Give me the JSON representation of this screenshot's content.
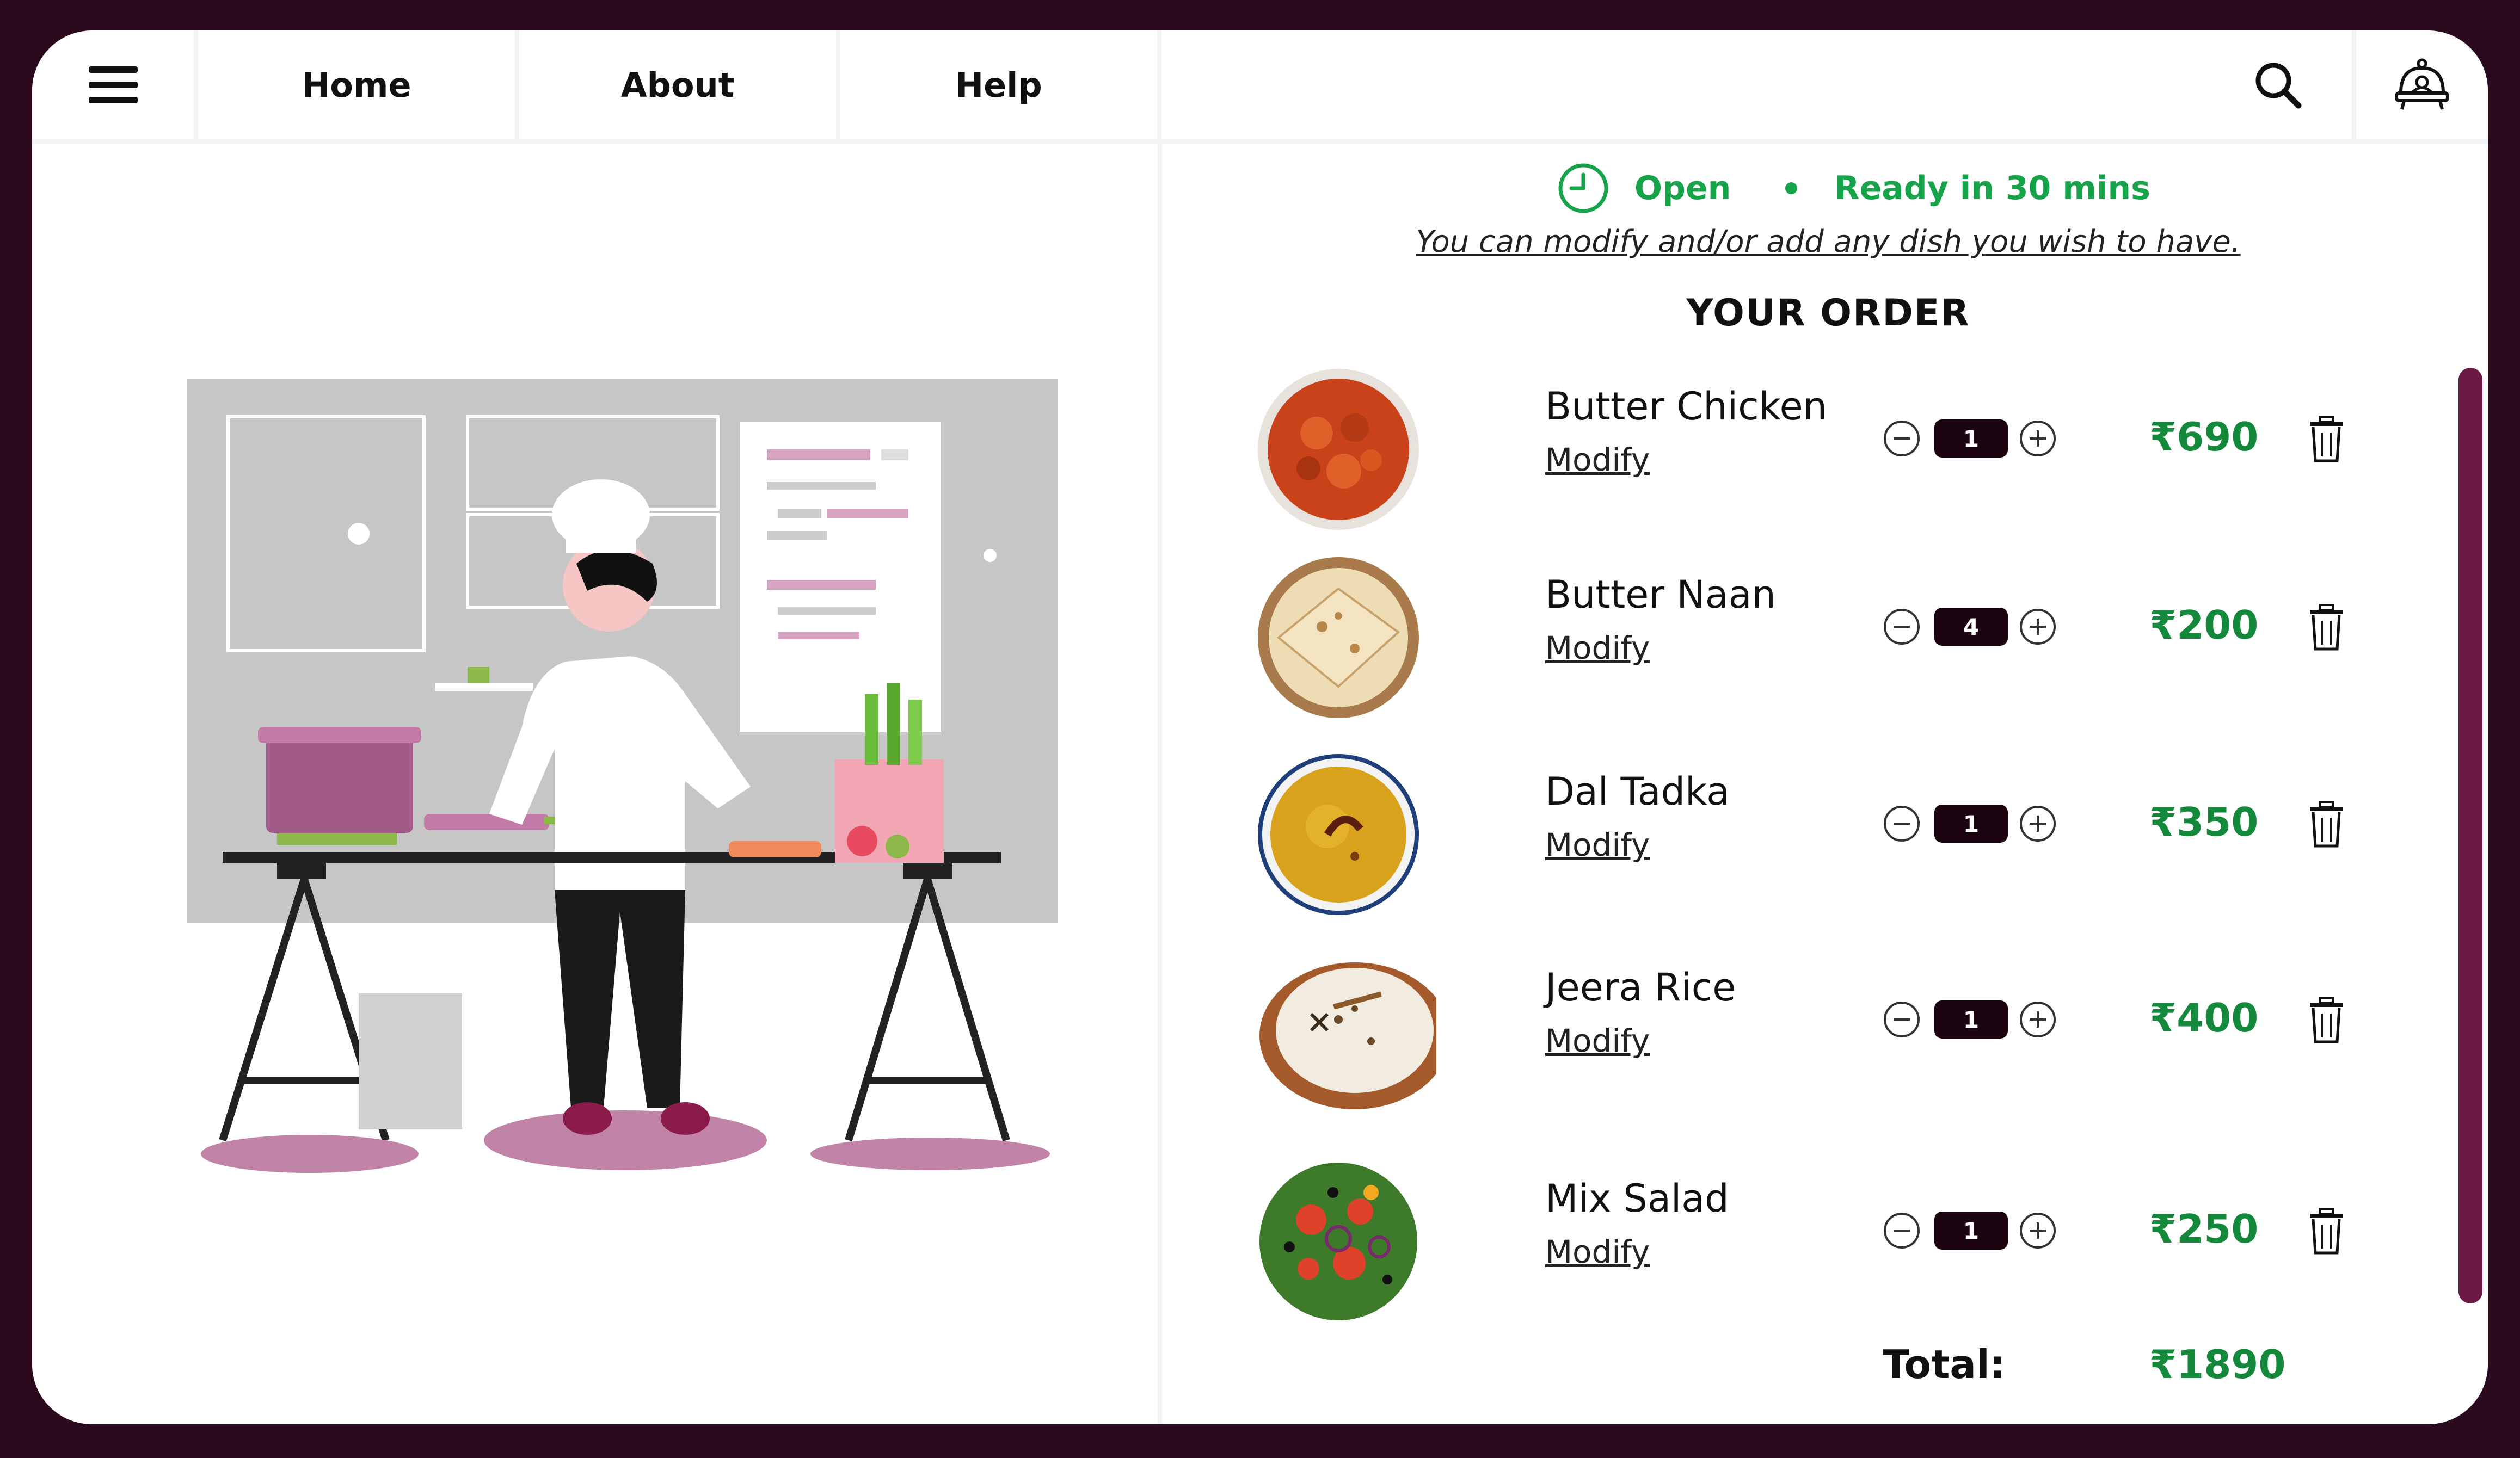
{
  "nav": {
    "items": [
      {
        "label": "Home"
      },
      {
        "label": "About"
      },
      {
        "label": "Help"
      }
    ]
  },
  "status": {
    "state": "Open",
    "eta": "Ready in 30 mins",
    "note": "You can modify and/or add any dish you wish to have."
  },
  "order": {
    "title": "YOUR ORDER",
    "items": [
      {
        "name": "Butter Chicken",
        "modify_label": "Modify",
        "qty": "1",
        "price": "₹690"
      },
      {
        "name": "Butter Naan",
        "modify_label": "Modify",
        "qty": "4",
        "price": "₹200"
      },
      {
        "name": "Dal Tadka",
        "modify_label": "Modify",
        "qty": "1",
        "price": "₹350"
      },
      {
        "name": "Jeera Rice",
        "modify_label": "Modify",
        "qty": "1",
        "price": "₹400"
      },
      {
        "name": "Mix Salad",
        "modify_label": "Modify",
        "qty": "1",
        "price": "₹250"
      }
    ],
    "total_label": "Total:",
    "total_value": "₹1890"
  },
  "colors": {
    "frame": "#2a0a1c",
    "accent_green": "#16a34a",
    "price_green": "#14893b",
    "qty_box": "#1d0411",
    "scrollbar": "#6b1a45"
  },
  "icons": [
    "hamburger-menu-icon",
    "search-icon",
    "chef-bell-icon",
    "clock-icon",
    "minus-circle-icon",
    "plus-circle-icon",
    "trash-icon"
  ]
}
